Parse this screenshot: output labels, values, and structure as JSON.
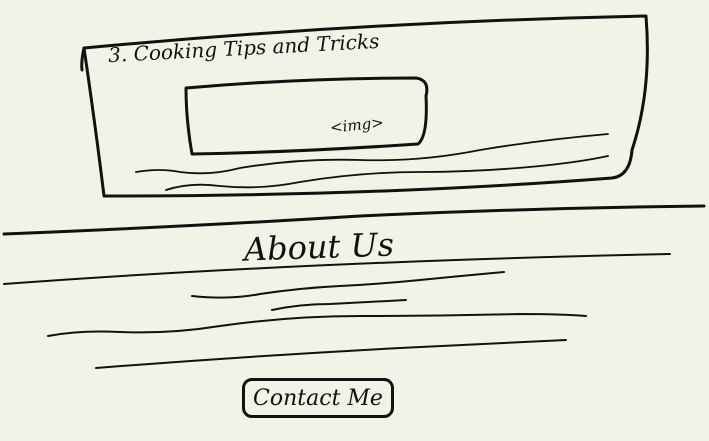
{
  "card": {
    "title": "3. Cooking Tips and Tricks",
    "image_placeholder": "<img>"
  },
  "about": {
    "title": "About Us"
  },
  "contact_button": {
    "label": "Contact Me"
  },
  "colors": {
    "background": "#f3f2e6",
    "ink": "#111111"
  }
}
